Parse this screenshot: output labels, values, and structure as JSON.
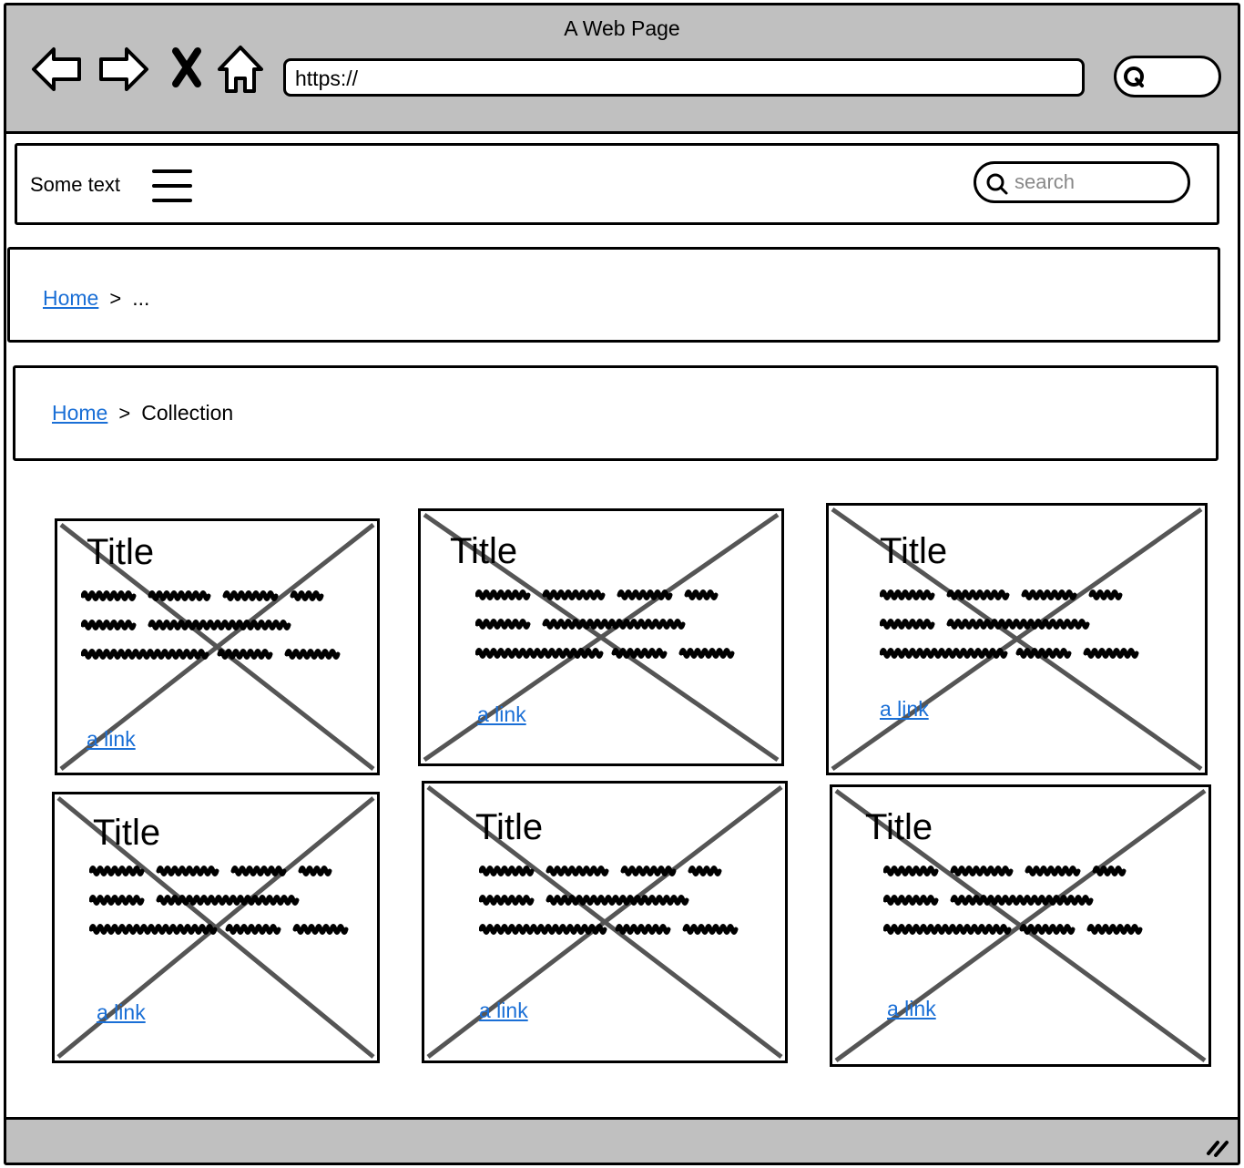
{
  "window": {
    "title": "A Web Page"
  },
  "browser": {
    "url": "https://"
  },
  "header": {
    "text": "Some text",
    "search_placeholder": "search"
  },
  "breadcrumb_1": {
    "home": "Home",
    "separator": ">",
    "rest": "..."
  },
  "breadcrumb_2": {
    "home": "Home",
    "separator": ">",
    "current": "Collection"
  },
  "cards": [
    {
      "title": "Title",
      "link": "a link"
    },
    {
      "title": "Title",
      "link": "a link"
    },
    {
      "title": "Title",
      "link": "a link"
    },
    {
      "title": "Title",
      "link": "a link"
    },
    {
      "title": "Title",
      "link": "a link"
    },
    {
      "title": "Title",
      "link": "a link"
    }
  ],
  "colors": {
    "link": "#1a6fd6",
    "chrome": "#c0c0c0",
    "placeholder_x": "#555555"
  }
}
